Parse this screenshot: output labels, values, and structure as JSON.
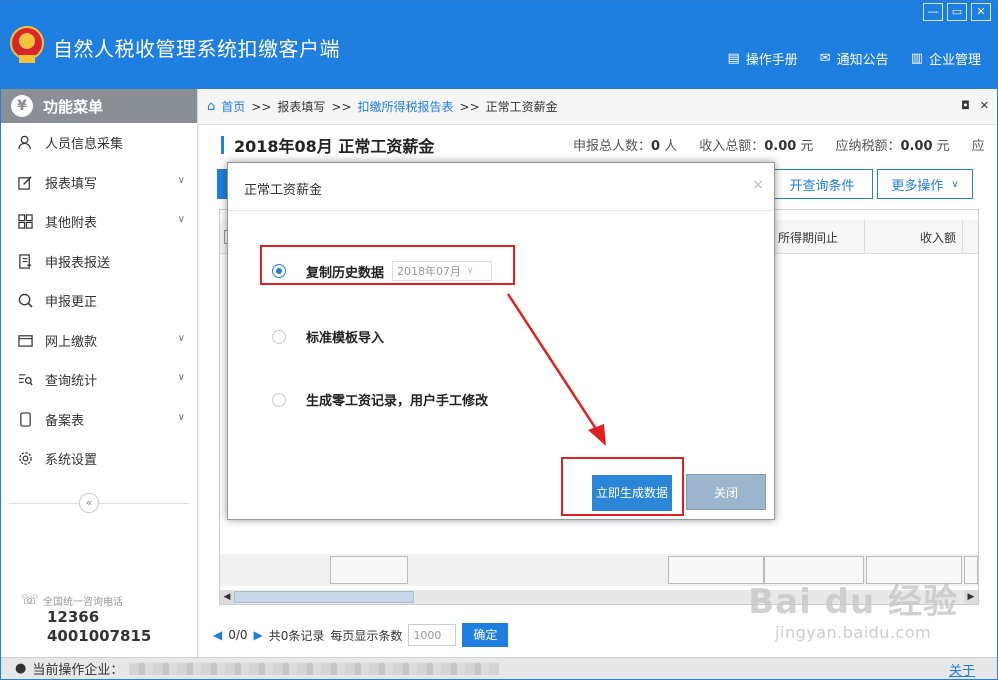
{
  "app": {
    "title": "自然人税收管理系统扣缴客户端",
    "header_links": [
      {
        "label": "操作手册",
        "icon": "manual-icon"
      },
      {
        "label": "通知公告",
        "icon": "mail-icon"
      },
      {
        "label": "企业管理",
        "icon": "building-icon"
      }
    ]
  },
  "sidebar": {
    "title": "功能菜单",
    "items": [
      {
        "label": "人员信息采集",
        "icon": "person-icon",
        "expandable": false
      },
      {
        "label": "报表填写",
        "icon": "edit-icon",
        "expandable": true
      },
      {
        "label": "其他附表",
        "icon": "grid-icon",
        "expandable": true
      },
      {
        "label": "申报表报送",
        "icon": "send-icon",
        "expandable": false
      },
      {
        "label": "申报更正",
        "icon": "search-icon",
        "expandable": false
      },
      {
        "label": "网上缴款",
        "icon": "wallet-icon",
        "expandable": true
      },
      {
        "label": "查询统计",
        "icon": "query-icon",
        "expandable": true
      },
      {
        "label": "备案表",
        "icon": "document-icon",
        "expandable": true
      },
      {
        "label": "系统设置",
        "icon": "gear-icon",
        "expandable": false
      }
    ],
    "collapse_label": "«",
    "hotline": {
      "label": "全国统一咨询电话",
      "numbers": [
        "12366",
        "4001007815"
      ]
    }
  },
  "breadcrumb": {
    "home": "首页",
    "separator": ">>",
    "items": [
      "报表填写",
      "扣缴所得税报告表",
      "正常工资薪金"
    ]
  },
  "page": {
    "title": "2018年08月  正常工资薪金",
    "stats": [
      {
        "label": "申报总人数：",
        "value": "0",
        "unit": " 人"
      },
      {
        "label": "收入总额：",
        "value": "0.00",
        "unit": " 元"
      },
      {
        "label": "应纳税额：",
        "value": "0.00",
        "unit": " 元"
      },
      {
        "label": "应",
        "value": "",
        "unit": ""
      }
    ],
    "buttons": {
      "query": "开查询条件",
      "more": "更多操作"
    },
    "columns": [
      "所得期间止",
      "收入额"
    ],
    "pager": {
      "status": "0/0",
      "records": "共0条记录",
      "per_page_label": "每页显示条数",
      "per_page_value": "1000",
      "confirm": "确定"
    }
  },
  "statusbar": {
    "label": "当前操作企业：",
    "about": "关于"
  },
  "modal": {
    "title": "正常工资薪金",
    "close": "×",
    "options": [
      {
        "label": "复制历史数据",
        "selected": true,
        "month": "2018年07月"
      },
      {
        "label": "标准模板导入",
        "selected": false
      },
      {
        "label": "生成零工资记录，用户手工修改",
        "selected": false
      }
    ],
    "generate_button": "立即生成数据",
    "close_button": "关闭"
  },
  "watermark": {
    "logo": "Bai du 经验",
    "url": "jingyan.baidu.com"
  },
  "colors": {
    "primary": "#1e7fe0",
    "highlight": "#e02020",
    "menu_head": "#8a8f96"
  }
}
